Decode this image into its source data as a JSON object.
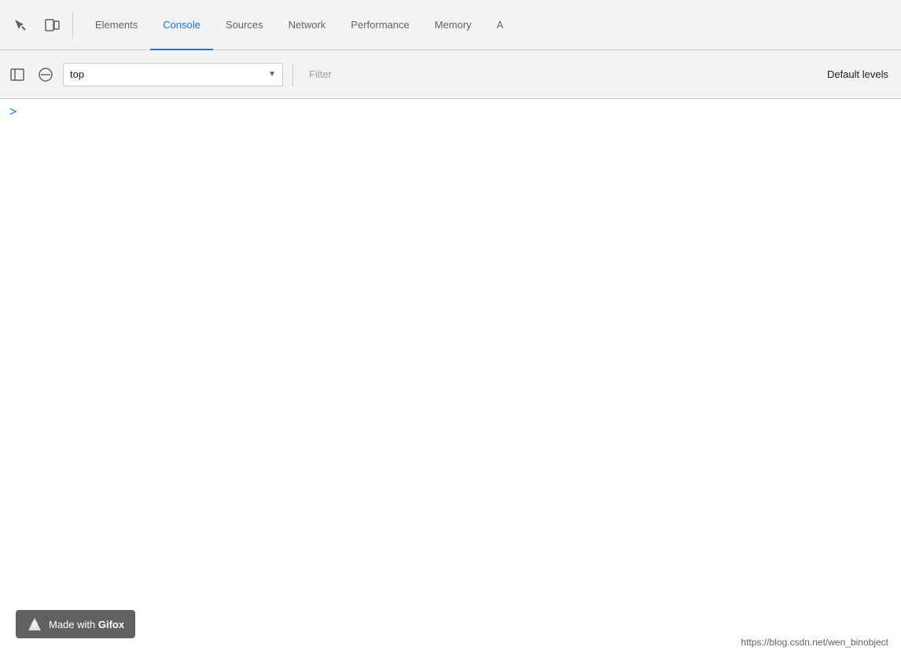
{
  "toolbar": {
    "tabs": [
      {
        "id": "elements",
        "label": "Elements",
        "active": false
      },
      {
        "id": "console",
        "label": "Console",
        "active": true
      },
      {
        "id": "sources",
        "label": "Sources",
        "active": false
      },
      {
        "id": "network",
        "label": "Network",
        "active": false
      },
      {
        "id": "performance",
        "label": "Performance",
        "active": false
      },
      {
        "id": "memory",
        "label": "Memory",
        "active": false
      },
      {
        "id": "application",
        "label": "A",
        "active": false
      }
    ]
  },
  "second_toolbar": {
    "context_label": "top",
    "filter_placeholder": "Filter",
    "default_levels_label": "Default levels"
  },
  "console": {
    "prompt_symbol": ">"
  },
  "watermark": {
    "prefix": "Made with",
    "brand": "Gifox"
  },
  "url": {
    "text": "https://blog.csdn.net/wen_binobject"
  }
}
